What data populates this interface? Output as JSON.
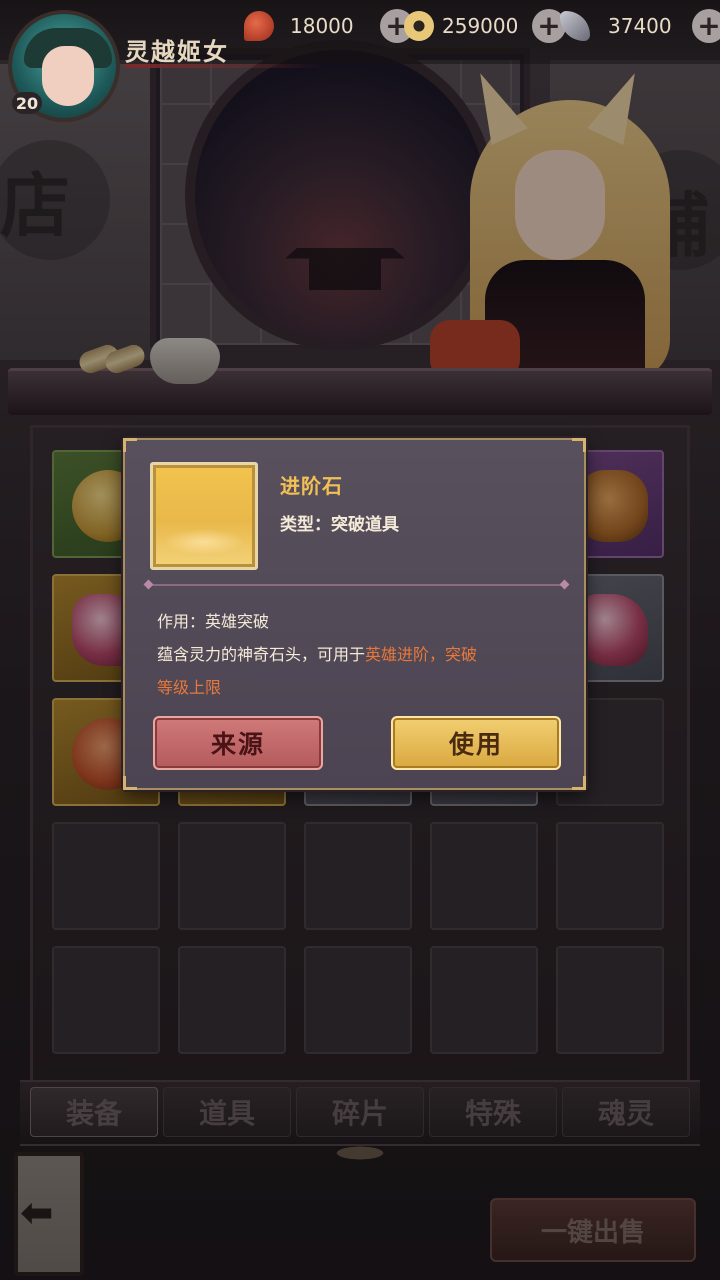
{
  "player": {
    "name": "灵越姬女",
    "level": "20"
  },
  "resources": [
    {
      "icon": "lingyu-icon",
      "value": "18000"
    },
    {
      "icon": "coin-icon",
      "value": "259000"
    },
    {
      "icon": "feather-icon",
      "value": "37400"
    }
  ],
  "background": {
    "shop_char_left": "店",
    "shop_char_right": "铺"
  },
  "tooltip": {
    "item_name": "进阶石",
    "item_type": "类型：突破道具",
    "effect": "作用：英雄突破",
    "desc_prefix": "蕴含灵力的神奇石头，可用于",
    "desc_highlight": "英雄进阶，突破",
    "desc_suffix": "等级上限",
    "source_button": "来源",
    "use_button": "使用",
    "highlight_color": "#e8783a",
    "name_color": "#f2c155"
  },
  "tabs": [
    {
      "label": "装备",
      "active": true
    },
    {
      "label": "道具",
      "active": false
    },
    {
      "label": "碎片",
      "active": false
    },
    {
      "label": "特殊",
      "active": false
    },
    {
      "label": "魂灵",
      "active": false
    }
  ],
  "bottom": {
    "sell_all_button": "一键出售",
    "back_arrow": "⬅"
  }
}
